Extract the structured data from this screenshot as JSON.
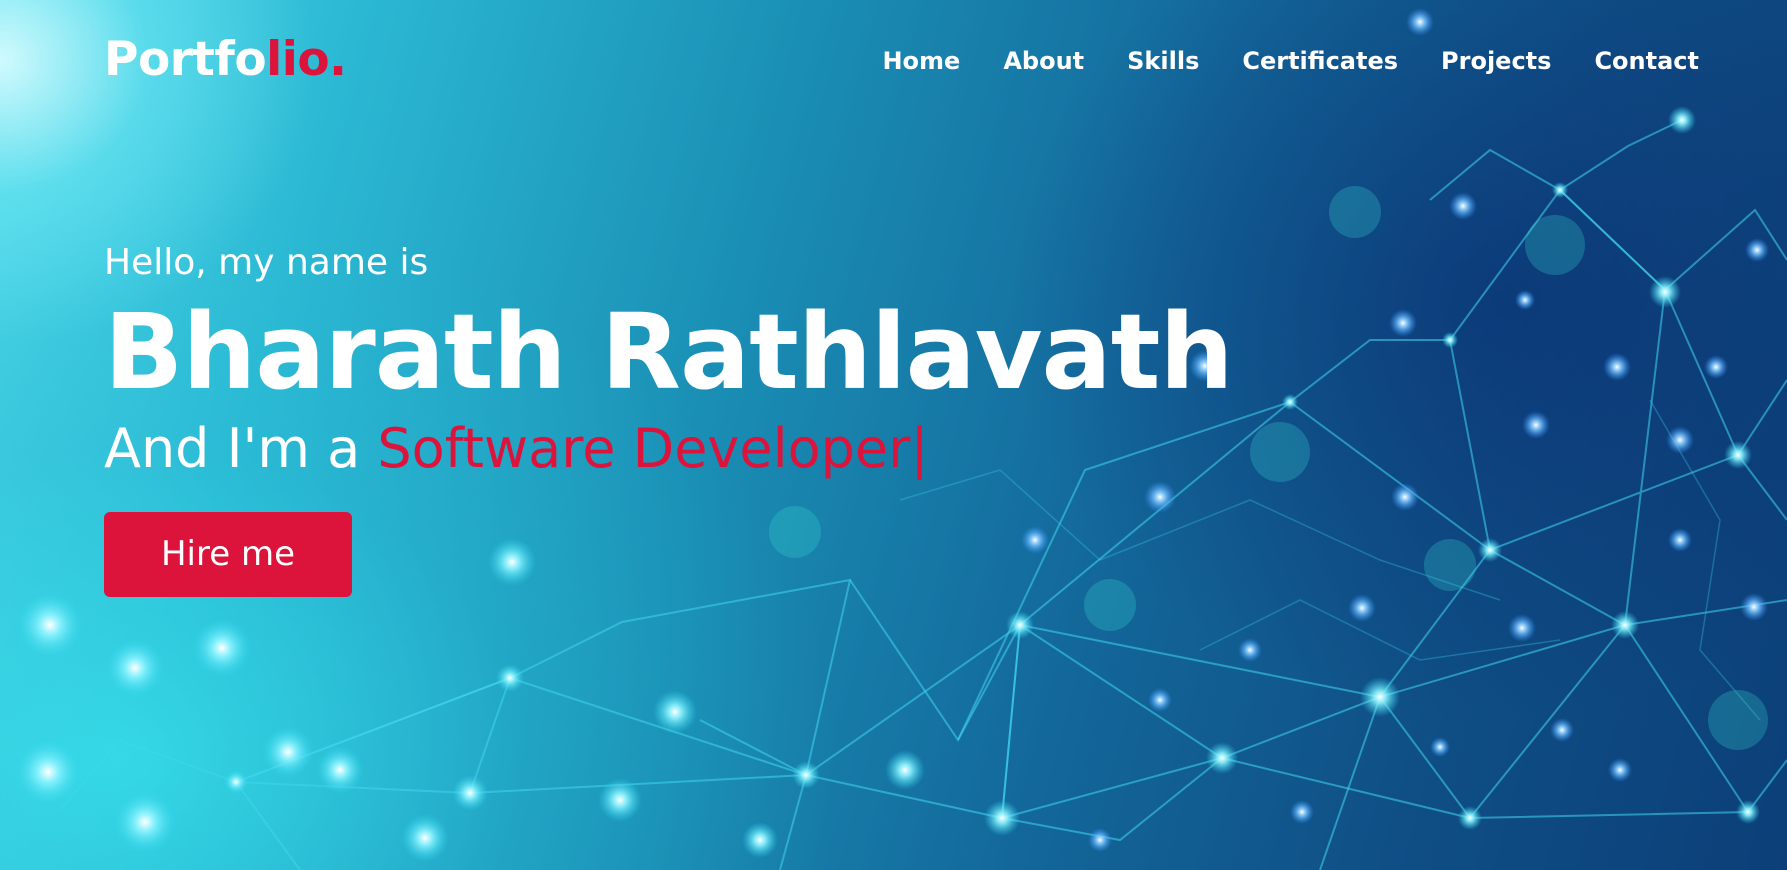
{
  "header": {
    "logo_main": "Portfo",
    "logo_accent": "lio."
  },
  "nav": {
    "items": [
      {
        "label": "Home"
      },
      {
        "label": "About"
      },
      {
        "label": "Skills"
      },
      {
        "label": "Certificates"
      },
      {
        "label": "Projects"
      },
      {
        "label": "Contact"
      }
    ]
  },
  "hero": {
    "greeting": "Hello, my name is",
    "name": "Bharath Rathlavath",
    "role_prefix": "And I'm a ",
    "role_typed": "Software Developer|",
    "cta_label": "Hire me"
  },
  "colors": {
    "accent": "#dc143c",
    "text": "#ffffff"
  }
}
